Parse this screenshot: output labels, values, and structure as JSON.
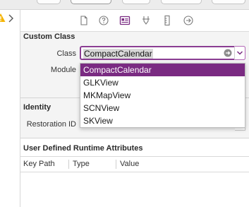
{
  "custom_class": {
    "title": "Custom Class",
    "class_label": "Class",
    "class_value": "CompactCalendar",
    "module_label": "Module",
    "dropdown_options": [
      "CompactCalendar",
      "GLKView",
      "MKMapView",
      "SCNView",
      "SKView"
    ],
    "selected_option": "CompactCalendar"
  },
  "identity": {
    "title": "Identity",
    "restoration_id_label": "Restoration ID"
  },
  "runtime_attributes": {
    "title": "User Defined Runtime Attributes",
    "columns": [
      "Key Path",
      "Type",
      "Value"
    ]
  },
  "inspector_tabs": [
    {
      "name": "file-inspector-icon"
    },
    {
      "name": "quick-help-icon"
    },
    {
      "name": "identity-inspector-icon",
      "active": true
    },
    {
      "name": "attributes-inspector-icon"
    },
    {
      "name": "size-inspector-icon"
    },
    {
      "name": "connections-inspector-icon"
    }
  ],
  "colors": {
    "accent": "#7a2b82",
    "accent_border": "#8a3d92",
    "warning": "#f5b400"
  }
}
